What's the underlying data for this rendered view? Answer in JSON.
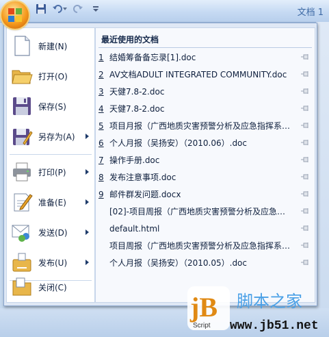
{
  "window": {
    "title": "文档 1"
  },
  "menu": {
    "items": [
      {
        "label": "新建(N)",
        "icon": "new-document-icon",
        "submenu": false
      },
      {
        "label": "打开(O)",
        "icon": "open-folder-icon",
        "submenu": false
      },
      {
        "label": "保存(S)",
        "icon": "save-disk-icon",
        "submenu": false
      },
      {
        "label": "另存为(A)",
        "icon": "save-as-icon",
        "submenu": true
      },
      {
        "label": "打印(P)",
        "icon": "printer-icon",
        "submenu": true
      },
      {
        "label": "准备(E)",
        "icon": "prepare-icon",
        "submenu": true
      },
      {
        "label": "发送(D)",
        "icon": "send-icon",
        "submenu": true
      },
      {
        "label": "发布(U)",
        "icon": "publish-icon",
        "submenu": true
      },
      {
        "label": "关闭(C)",
        "icon": "close-folder-icon",
        "submenu": false
      }
    ]
  },
  "recent": {
    "title": "最近使用的文档",
    "docs": [
      {
        "num": "1",
        "name": "结婚筹备备忘录[1].doc"
      },
      {
        "num": "2",
        "name": "AV文档ADULT INTEGRATED COMMUNITY.doc"
      },
      {
        "num": "3",
        "name": "天健7.8-2.doc"
      },
      {
        "num": "4",
        "name": "天健7.8-2.doc"
      },
      {
        "num": "5",
        "name": "项目月报（广西地质灾害预警分析及应急指挥系统..."
      },
      {
        "num": "6",
        "name": "个人月报（吴扬安）（2010.06）.doc"
      },
      {
        "num": "7",
        "name": "操作手册.doc"
      },
      {
        "num": "8",
        "name": "发布注意事项.doc"
      },
      {
        "num": "9",
        "name": "邮件群发问题.docx"
      },
      {
        "num": "",
        "name": "[02]-项目周报（广西地质灾害预警分析及应急指..."
      },
      {
        "num": "",
        "name": "default.html"
      },
      {
        "num": "",
        "name": "项目周报（广西地质灾害预警分析及应急指挥系统..."
      },
      {
        "num": "",
        "name": "个人月报（吴扬安）（2010.05）.doc"
      }
    ]
  },
  "watermark": {
    "logo_text": "jB",
    "sub": "Script",
    "site_cn": "脚本之家",
    "site_url": "www.jb51.net"
  },
  "colors": {
    "accent": "#f59a1c",
    "menu_bg": "#dfe8f5",
    "text": "#0e1f3d"
  }
}
